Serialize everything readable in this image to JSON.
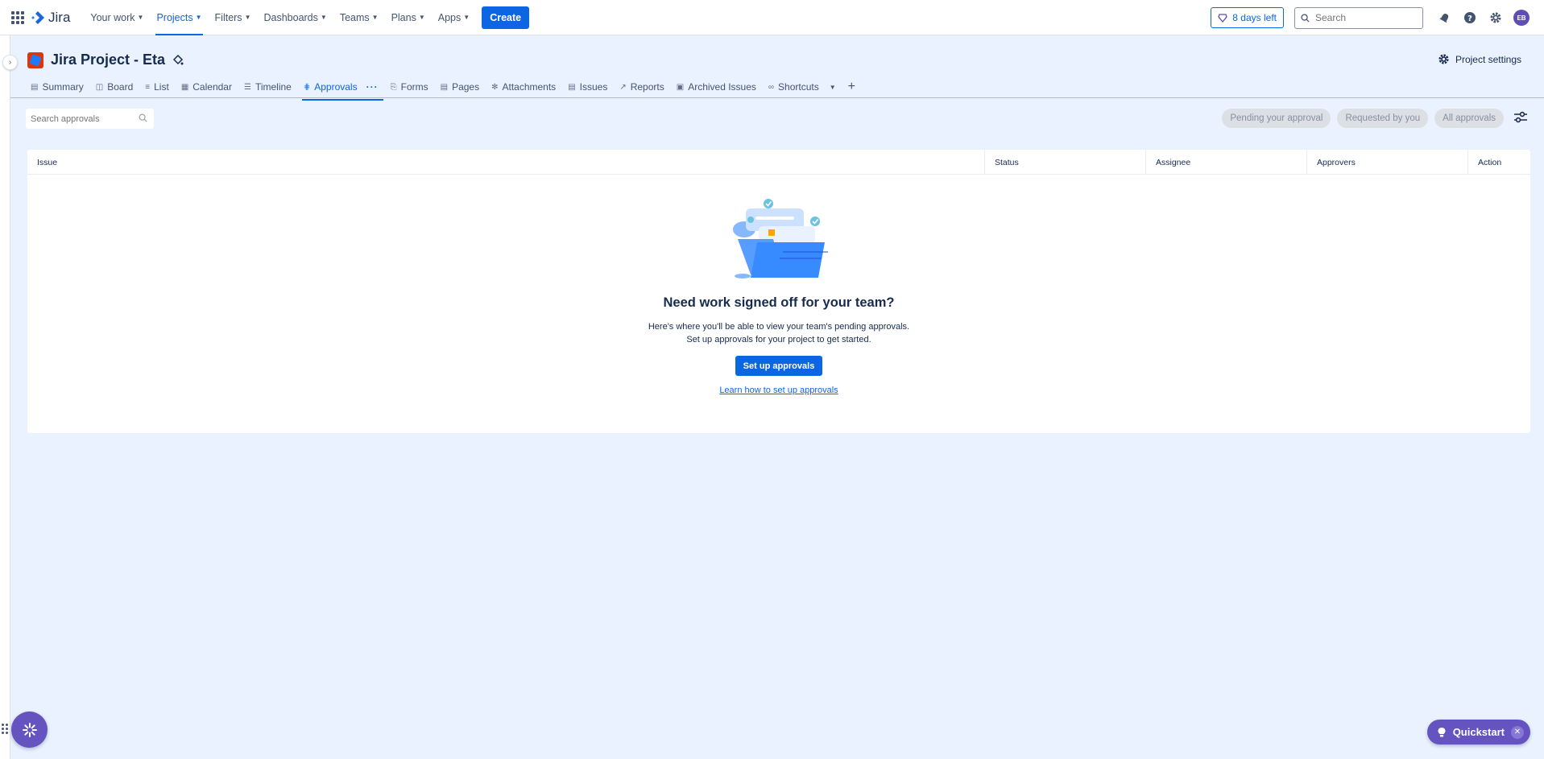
{
  "topnav": {
    "logo_text": "Jira",
    "items": [
      {
        "label": "Your work"
      },
      {
        "label": "Projects"
      },
      {
        "label": "Filters"
      },
      {
        "label": "Dashboards"
      },
      {
        "label": "Teams"
      },
      {
        "label": "Plans"
      },
      {
        "label": "Apps"
      }
    ],
    "active_item": "Projects",
    "create_label": "Create",
    "trial_label": "8 days left",
    "search_placeholder": "Search",
    "avatar_initials": "EB"
  },
  "project": {
    "title": "Jira Project - Eta",
    "settings_label": "Project settings"
  },
  "tabs": [
    {
      "label": "Summary",
      "icon": "summary-icon"
    },
    {
      "label": "Board",
      "icon": "board-icon"
    },
    {
      "label": "List",
      "icon": "list-icon"
    },
    {
      "label": "Calendar",
      "icon": "calendar-icon"
    },
    {
      "label": "Timeline",
      "icon": "timeline-icon"
    },
    {
      "label": "Approvals",
      "icon": "approvals-icon",
      "active": true
    },
    {
      "label": "Forms",
      "icon": "forms-icon"
    },
    {
      "label": "Pages",
      "icon": "pages-icon"
    },
    {
      "label": "Attachments",
      "icon": "attachments-icon"
    },
    {
      "label": "Issues",
      "icon": "issues-icon"
    },
    {
      "label": "Reports",
      "icon": "reports-icon"
    },
    {
      "label": "Archived Issues",
      "icon": "archive-icon"
    },
    {
      "label": "Shortcuts",
      "icon": "link-icon"
    }
  ],
  "filters": {
    "search_placeholder": "Search approvals",
    "pills": [
      "Pending your approval",
      "Requested by you",
      "All approvals"
    ]
  },
  "table": {
    "columns": [
      "Issue",
      "Status",
      "Assignee",
      "Approvers",
      "Action"
    ]
  },
  "empty_state": {
    "heading": "Need work signed off for your team?",
    "line1": "Here's where you'll be able to view your team's pending approvals.",
    "line2": "Set up approvals for your project to get started.",
    "button_label": "Set up approvals",
    "link_label": "Learn how to set up approvals"
  },
  "quickstart": {
    "label": "Quickstart"
  },
  "colors": {
    "brand": "#0C66E4",
    "page_bg": "#E9F2FE",
    "purple": "#6554C0"
  }
}
